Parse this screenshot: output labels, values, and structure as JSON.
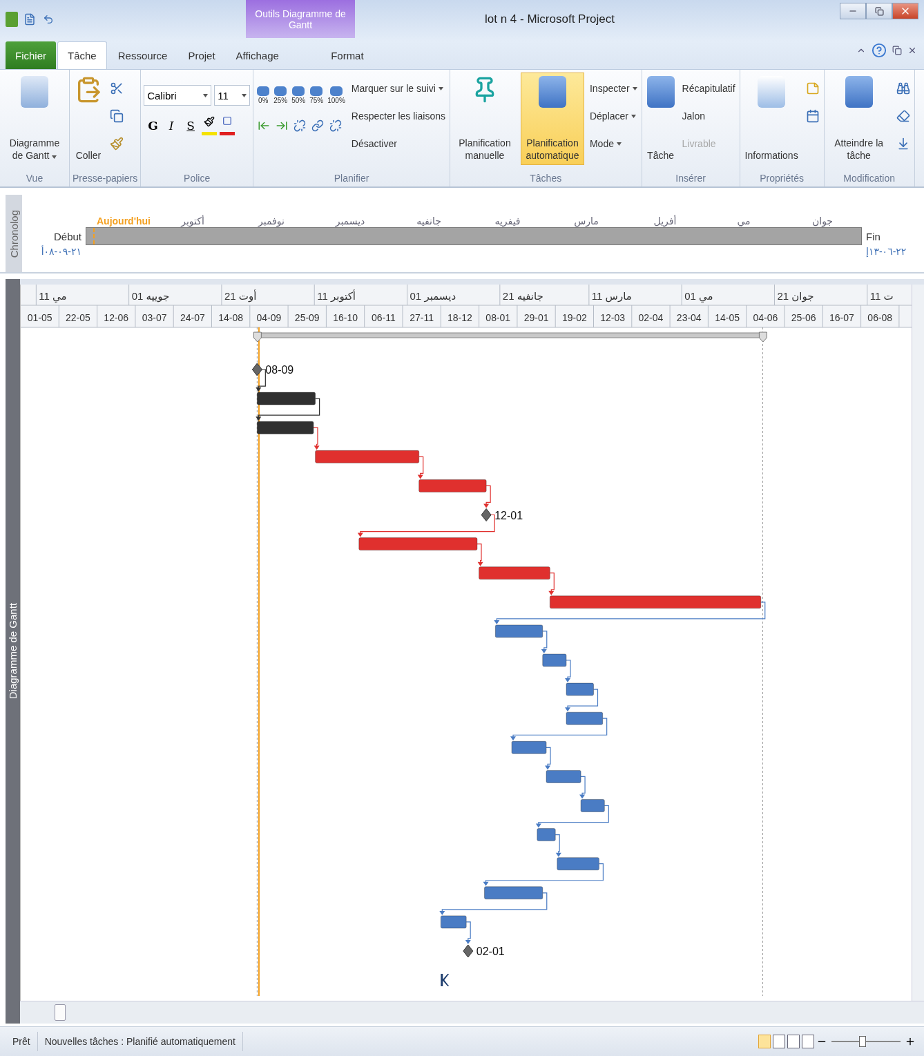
{
  "window": {
    "title": "lot n 4  -  Microsoft Project",
    "context_tab": "Outils Diagramme de Gantt"
  },
  "tabs": [
    {
      "label": "Fichier",
      "kind": "file",
      "selected": false
    },
    {
      "label": "Tâche",
      "kind": "tab",
      "selected": true
    },
    {
      "label": "Ressource",
      "kind": "tab",
      "selected": false
    },
    {
      "label": "Projet",
      "kind": "tab",
      "selected": false
    },
    {
      "label": "Affichage",
      "kind": "tab",
      "selected": false
    },
    {
      "label": "Format",
      "kind": "context",
      "selected": false
    }
  ],
  "ribbon": {
    "view": {
      "label": "Vue",
      "button": "Diagramme de Gantt"
    },
    "clipboard": {
      "label": "Presse-papiers",
      "button": "Coller"
    },
    "font": {
      "label": "Police",
      "family": "Calibri",
      "size": "11",
      "styles": [
        "G",
        "I",
        "S"
      ]
    },
    "schedule": {
      "label": "Planifier",
      "percents": [
        "0%",
        "25%",
        "50%",
        "75%",
        "100%"
      ],
      "actions": [
        {
          "label": "Marquer sur le suivi",
          "dropdown": true
        },
        {
          "label": "Respecter les liaisons",
          "dropdown": false
        },
        {
          "label": "Désactiver",
          "dropdown": false
        }
      ]
    },
    "tasks": {
      "label": "Tâches",
      "modes": [
        {
          "label": "Planification manuelle",
          "selected": false
        },
        {
          "label": "Planification automatique",
          "selected": true
        }
      ],
      "actions": [
        {
          "label": "Inspecter",
          "dropdown": true
        },
        {
          "label": "Déplacer",
          "dropdown": true
        },
        {
          "label": "Mode",
          "dropdown": true
        }
      ]
    },
    "insert": {
      "label": "Insérer",
      "button": "Tâche",
      "actions": [
        {
          "label": "Récapitulatif",
          "disabled": false
        },
        {
          "label": "Jalon",
          "disabled": false
        },
        {
          "label": "Livrable",
          "disabled": true
        }
      ]
    },
    "properties": {
      "label": "Propriétés",
      "button": "Informations"
    },
    "editing": {
      "label": "Modification",
      "button": "Atteindre la tâche"
    }
  },
  "timeline": {
    "side_label": "Chronolog",
    "today": "Aujourd'hui",
    "months": [
      "جوان",
      "مي",
      "أفريل",
      "مارس",
      "فيفريه",
      "جانفيه",
      "ديسمبر",
      "نوفمبر",
      "أكتوبر"
    ],
    "start_label": "Début",
    "finish_label": "Fin",
    "start_date": "٢١-٠٩-٠٨أ",
    "finish_date": "٢٢-٠٦-١٣إ"
  },
  "gantt": {
    "side_label": "Diagramme de Gantt",
    "top_tier": [
      "ت 11",
      "جوان 21",
      "مي 01",
      "مارس 11",
      "جانفيه 21",
      "ديسمبر 01",
      "أكتوبر 11",
      "أوت 21",
      "جوييه 01",
      "مي 11"
    ],
    "bottom_tier": [
      "01-05",
      "22-05",
      "12-06",
      "03-07",
      "24-07",
      "14-08",
      "04-09",
      "25-09",
      "16-10",
      "06-11",
      "27-11",
      "18-12",
      "08-01",
      "29-01",
      "19-02",
      "12-03",
      "02-04",
      "23-04",
      "14-05",
      "04-06",
      "25-06",
      "16-07",
      "06-08"
    ],
    "tasks": [
      {
        "kind": "milestone",
        "label": "08-09"
      },
      {
        "kind": "bar",
        "color": "#303030"
      },
      {
        "kind": "bar",
        "color": "#303030"
      },
      {
        "kind": "bar",
        "color": "#e0302e"
      },
      {
        "kind": "bar",
        "color": "#e0302e"
      },
      {
        "kind": "milestone",
        "label": "12-01"
      },
      {
        "kind": "bar",
        "color": "#e0302e"
      },
      {
        "kind": "bar",
        "color": "#e0302e"
      },
      {
        "kind": "bar",
        "color": "#e0302e"
      },
      {
        "kind": "bar",
        "color": "#4a7cc4"
      },
      {
        "kind": "bar",
        "color": "#4a7cc4"
      },
      {
        "kind": "bar",
        "color": "#4a7cc4"
      },
      {
        "kind": "bar",
        "color": "#4a7cc4"
      },
      {
        "kind": "bar",
        "color": "#4a7cc4"
      },
      {
        "kind": "bar",
        "color": "#4a7cc4"
      },
      {
        "kind": "bar",
        "color": "#4a7cc4"
      },
      {
        "kind": "bar",
        "color": "#4a7cc4"
      },
      {
        "kind": "bar",
        "color": "#4a7cc4"
      },
      {
        "kind": "bar",
        "color": "#4a7cc4"
      },
      {
        "kind": "bar",
        "color": "#4a7cc4"
      },
      {
        "kind": "milestone",
        "label": "02-01"
      },
      {
        "kind": "marker"
      }
    ]
  },
  "status_bar": {
    "ready": "Prêt",
    "new_tasks": "Nouvelles tâches : Planifié automatiquement",
    "zoom": {
      "level": 0.45
    }
  }
}
